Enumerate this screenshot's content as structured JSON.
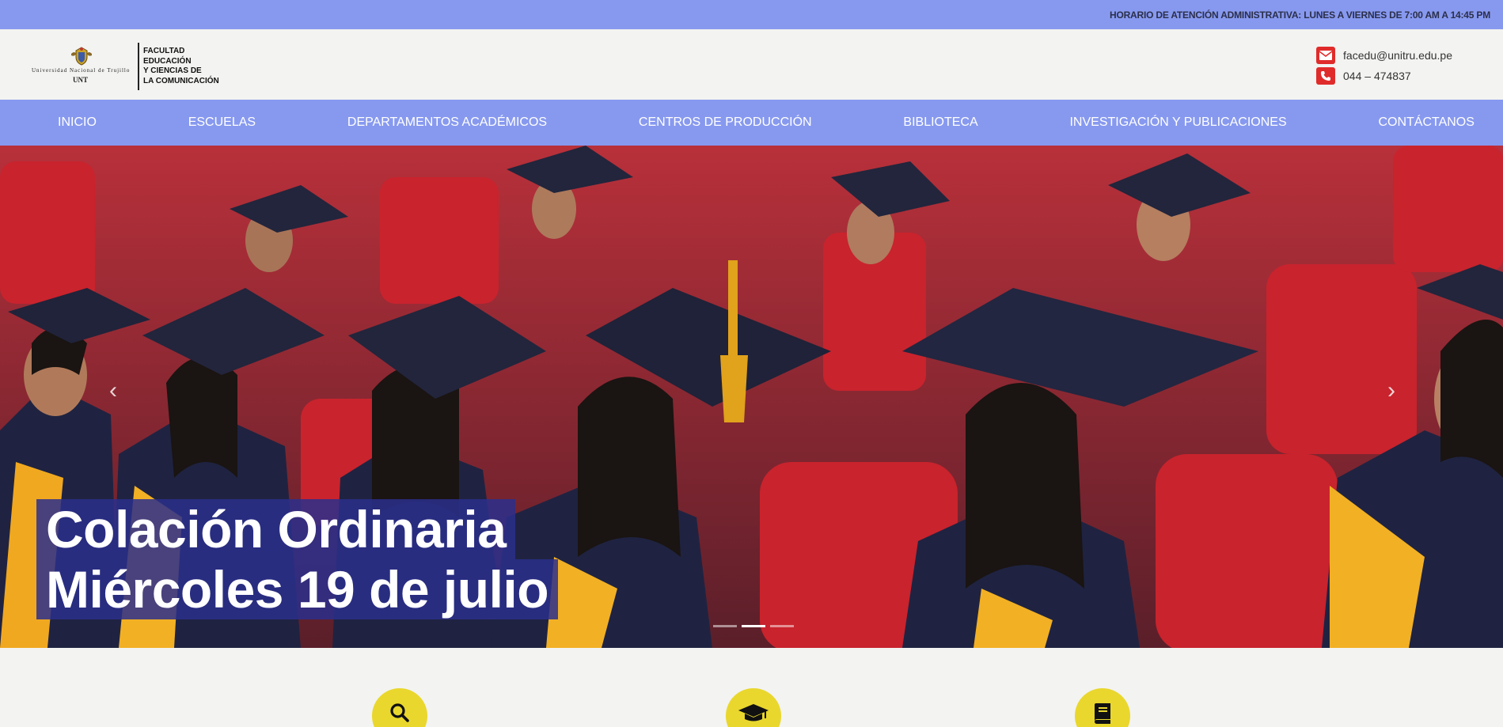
{
  "topbar": {
    "schedule": "HORARIO DE ATENCIÓN ADMINISTRATIVA: LUNES A VIERNES DE 7:00 AM A 14:45 PM"
  },
  "logo": {
    "university_name": "Universidad Nacional de Trujillo",
    "university_abbr": "UNT",
    "faculty_lines": [
      "FACULTAD",
      "EDUCACIÓN",
      "Y CIENCIAS DE",
      "LA COMUNICACIÓN"
    ]
  },
  "contact": {
    "email": "facedu@unitru.edu.pe",
    "phone": "044 – 474837"
  },
  "nav": [
    {
      "label": "INICIO"
    },
    {
      "label": "ESCUELAS"
    },
    {
      "label": "DEPARTAMENTOS ACADÉMICOS"
    },
    {
      "label": "CENTROS DE PRODUCCIÓN"
    },
    {
      "label": "BIBLIOTECA"
    },
    {
      "label": "INVESTIGACIÓN Y PUBLICACIONES"
    },
    {
      "label": "CONTÁCTANOS"
    }
  ],
  "hero": {
    "caption_line1": "Colación Ordinaria",
    "caption_line2": "Miércoles 19 de julio",
    "slide_count": 3,
    "active_slide": 2
  },
  "features": [
    {
      "icon": "search-icon"
    },
    {
      "icon": "graduation-cap-icon"
    },
    {
      "icon": "book-icon"
    }
  ],
  "colors": {
    "accent": "#8799ef",
    "caption_bg": "#2b2f8c",
    "feature_circle": "#e9d72d",
    "contact_icon": "#e02b2b"
  }
}
